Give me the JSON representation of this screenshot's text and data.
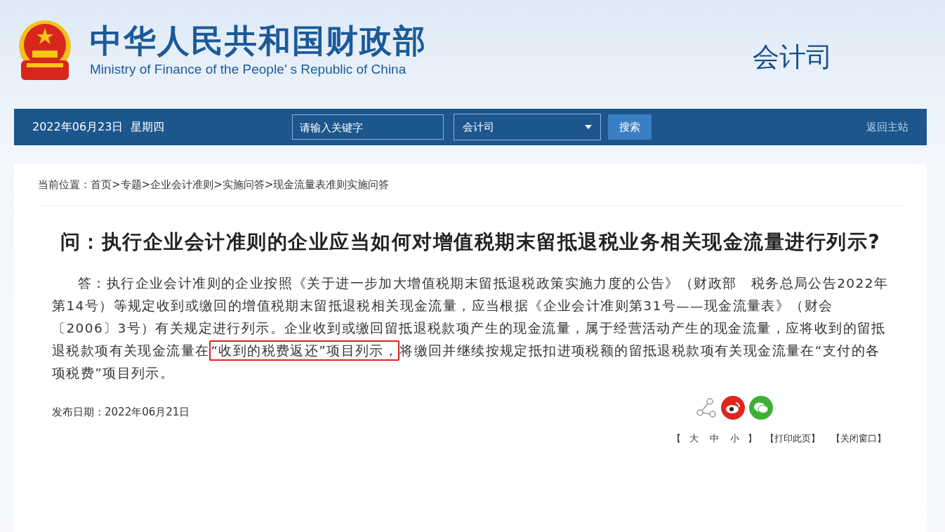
{
  "header": {
    "title": "中华人民共和国财政部",
    "subtitle": "Ministry of Finance of the People’ s Republic of China",
    "department": "会计司"
  },
  "navbar": {
    "date": "2022年06月23日  星期四",
    "search": {
      "placeholder": "请输入关键字"
    },
    "select": {
      "value": "会计司"
    },
    "search_button": "搜索",
    "home_link": "返回主站"
  },
  "breadcrumb": {
    "label": "当前位置：",
    "items": [
      "首页",
      ">",
      "专题",
      ">",
      "企业会计准则",
      ">",
      "实施问答",
      ">",
      "现金流量表准则实施问答"
    ]
  },
  "article": {
    "title": "问：执行企业会计准则的企业应当如何对增值税期末留抵退税业务相关现金流量进行列示?",
    "body": {
      "before": "答：执行企业会计准则的企业按照《关于进一步加大增值税期末留抵退税政策实施力度的公告》（财政部　税务总局公告2022年第14号）等规定收到或缴回的增值税期末留抵退税相关现金流量，应当根据《企业会计准则第31号——现金流量表》（财会〔2006〕3号）有关规定进行列示。企业收到或缴回留抵退税款项产生的现金流量，属于经营活动产生的现金流量，应将收到的留抵退税款项有关现金流量在",
      "highlighted": "“收到的税费返还”项目列示，",
      "after": "将缴回并继续按规定抵扣进项税额的留抵退税款项有关现金流量在“支付的各项税费”项目列示。"
    },
    "date": "发布日期：2022年06月21日"
  },
  "share": [
    {
      "kind": "share",
      "color": "#ffffff"
    },
    {
      "kind": "weibo",
      "color": "#e0261b"
    },
    {
      "kind": "wechat",
      "color": "#3cb034"
    }
  ],
  "font_size": {
    "open": "【",
    "sizes": [
      "大",
      "中",
      "小"
    ],
    "close": "】"
  },
  "actions": [
    "【打印此页】",
    "【关闭窗口】"
  ]
}
